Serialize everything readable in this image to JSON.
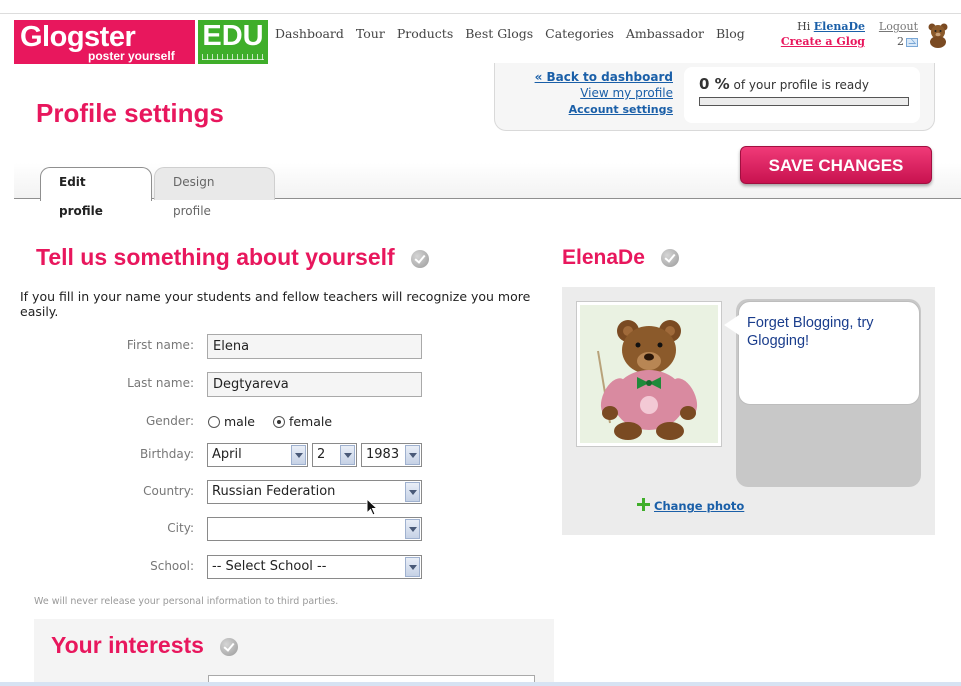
{
  "brand": {
    "name": "Glogster",
    "tagline": "poster yourself",
    "edu": "EDU",
    "color": "#e8175d",
    "edu_color": "#3fae2a"
  },
  "nav": [
    "Dashboard",
    "Tour",
    "Products",
    "Best Glogs",
    "Categories",
    "Ambassador",
    "Blog"
  ],
  "user": {
    "greeting": "Hi",
    "username": "ElenaDe",
    "create_link": "Create a Glog",
    "logout": "Logout",
    "messages_count": "2"
  },
  "status_links": {
    "back": "« Back to dashboard",
    "view": "View my profile",
    "account": "Account settings"
  },
  "profile_progress": {
    "value": "0 %",
    "text": "of your profile is ready",
    "fraction": 0
  },
  "page_title": "Profile settings",
  "tabs": [
    {
      "label": "Edit profile",
      "active": true
    },
    {
      "label": "Design profile",
      "active": false
    }
  ],
  "save_label": "SAVE CHANGES",
  "about": {
    "heading": "Tell us something about yourself",
    "intro": "If you fill in your name your students and fellow teachers will recognize you more easily."
  },
  "form": {
    "first_name": {
      "label": "First name:",
      "value": "Elena"
    },
    "last_name": {
      "label": "Last name:",
      "value": "Degtyareva"
    },
    "gender": {
      "label": "Gender:",
      "options": [
        "male",
        "female"
      ],
      "selected": "female"
    },
    "birthday": {
      "label": "Birthday:",
      "month": "April",
      "day": "2",
      "year": "1983"
    },
    "country": {
      "label": "Country:",
      "value": "Russian Federation"
    },
    "city": {
      "label": "City:",
      "value": ""
    },
    "school": {
      "label": "School:",
      "value": "-- Select School --"
    }
  },
  "privacy_note": "We will never release your personal information to third parties.",
  "interests": {
    "heading": "Your interests"
  },
  "profile_card": {
    "name": "ElenaDe",
    "bubble_text": "Forget Blogging, try Glogging!",
    "change_photo": "Change photo"
  }
}
